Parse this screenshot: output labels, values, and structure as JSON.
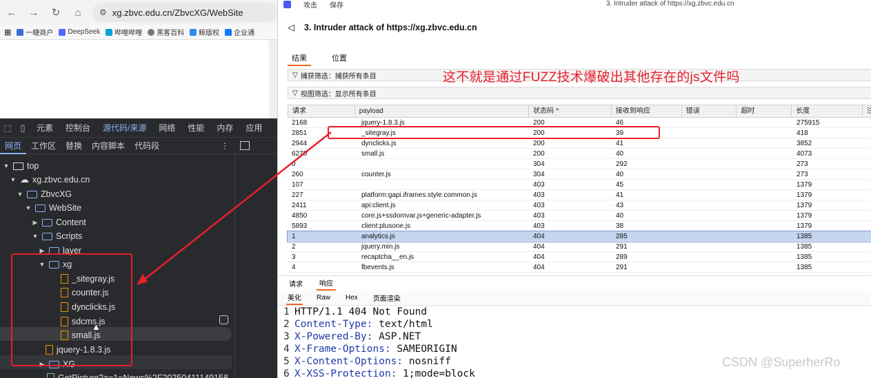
{
  "browser": {
    "url": "xg.zbvc.edu.cn/ZbvcXG/WebSite",
    "bookmarks": [
      "一睫商户",
      "DeepSeek",
      "哔哩哔哩",
      "黑客百科",
      "鲸版权",
      "企业通"
    ]
  },
  "devtools": {
    "tabs": [
      "元素",
      "控制台",
      "源代码/来源",
      "网络",
      "性能",
      "内存",
      "应用"
    ],
    "active_tab": "源代码/来源",
    "subtabs": [
      "网页",
      "工作区",
      "替换",
      "内容脚本",
      "代码段"
    ],
    "tree": {
      "top": "top",
      "domain": "xg.zbvc.edu.cn",
      "folder1": "ZbvcXG",
      "folder2": "WebSite",
      "content": "Content",
      "scripts": "Scripts",
      "layer": "layer",
      "xg": "xg",
      "files": [
        "_sitegray.js",
        "counter.js",
        "dynclicks.js",
        "sdcms.js",
        "small.js"
      ],
      "jquery": "jquery-1.8.3.js",
      "xg2": "XG",
      "getpicture": "GetPicture?a=1=News%2F20250411149158"
    }
  },
  "burp": {
    "menu": [
      "攻击",
      "保存"
    ],
    "window_title": "3. Intruder attack of https://xg.zbvc.edu.cn",
    "attack_title": "3. Intruder attack of https://xg.zbvc.edu.cn",
    "tabs": [
      "结果",
      "位置"
    ],
    "filter1": "捕获筛选：捕获所有条目",
    "filter2": "视图筛选：显示所有条目",
    "annotation": "这不就是通过FUZZ技术爆破出其他存在的js文件吗",
    "columns": [
      "请求",
      "payload",
      "状态码 ^",
      "接收到响应",
      "错误",
      "超时",
      "长度",
      "注"
    ],
    "rows": [
      [
        "2168",
        "jquery-1.8.3.js",
        "200",
        "46",
        "",
        "",
        "275915"
      ],
      [
        "2851",
        "_sitegray.js",
        "200",
        "39",
        "",
        "",
        "418"
      ],
      [
        "2944",
        "dynclicks.js",
        "200",
        "41",
        "",
        "",
        "3852"
      ],
      [
        "6270",
        "small.js",
        "200",
        "40",
        "",
        "",
        "4073"
      ],
      [
        "0",
        "",
        "304",
        "292",
        "",
        "",
        "273"
      ],
      [
        "260",
        "counter.js",
        "304",
        "40",
        "",
        "",
        "273"
      ],
      [
        "107",
        "",
        "403",
        "45",
        "",
        "",
        "1379"
      ],
      [
        "227",
        "platform:gapi.iframes.style.common.js",
        "403",
        "41",
        "",
        "",
        "1379"
      ],
      [
        "2411",
        "api:client.js",
        "403",
        "43",
        "",
        "",
        "1379"
      ],
      [
        "4850",
        "core.js+ssdomvar.js+generic-adapter.js",
        "403",
        "40",
        "",
        "",
        "1379"
      ],
      [
        "5893",
        "client:plusone.js",
        "403",
        "38",
        "",
        "",
        "1379"
      ],
      [
        "1",
        "analytics.js",
        "404",
        "285",
        "",
        "",
        "1385"
      ],
      [
        "2",
        "jquery.min.js",
        "404",
        "291",
        "",
        "",
        "1385"
      ],
      [
        "3",
        "recaptcha__en.js",
        "404",
        "289",
        "",
        "",
        "1385"
      ],
      [
        "4",
        "fbevents.js",
        "404",
        "291",
        "",
        "",
        "1385"
      ]
    ],
    "req_resp_tabs": [
      "请求",
      "响应"
    ],
    "format_tabs": [
      "美化",
      "Raw",
      "Hex",
      "页面渲染"
    ],
    "response_lines": [
      {
        "n": "1",
        "key": "HTTP/1.1 404 Not Found",
        "val": ""
      },
      {
        "n": "2",
        "key": "Content-Type:",
        "val": " text/html"
      },
      {
        "n": "3",
        "key": "X-Powered-By:",
        "val": " ASP.NET"
      },
      {
        "n": "4",
        "key": "X-Frame-Options:",
        "val": " SAMEORIGIN"
      },
      {
        "n": "5",
        "key": "X-Content-Options:",
        "val": " nosniff"
      },
      {
        "n": "6",
        "key": "X-XSS-Protection:",
        "val": " 1;mode=block"
      }
    ],
    "watermark": "CSDN @SuperherRo"
  },
  "colors": {
    "highlight_red": "#e8202a",
    "devtools_bg": "#292a2d",
    "selected_row": "#c4d5ef",
    "accent_orange": "#f26522"
  }
}
